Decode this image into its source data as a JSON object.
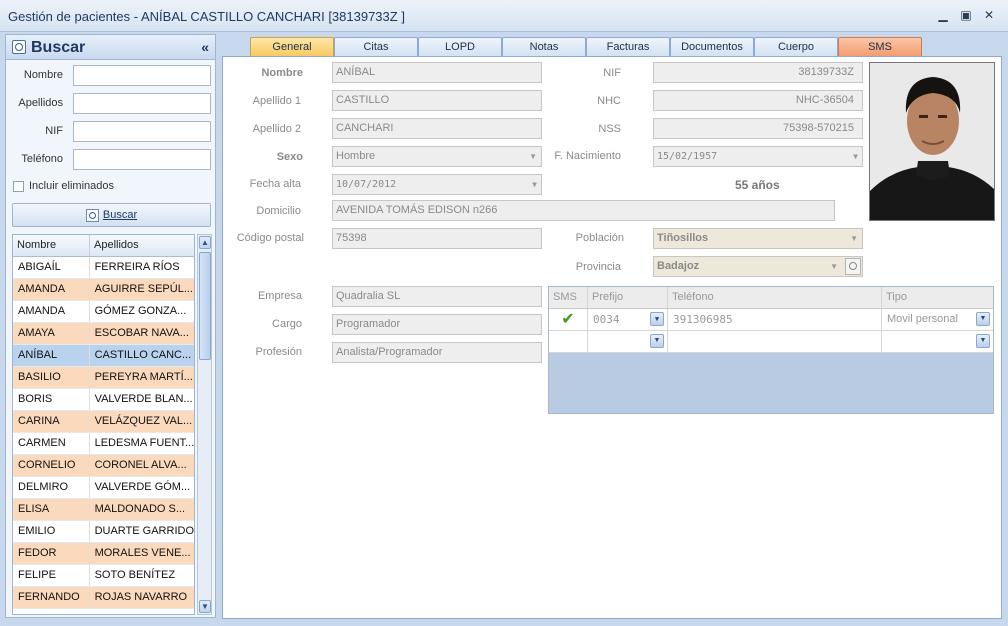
{
  "window": {
    "title": "Gestión de pacientes - ANÍBAL CASTILLO CANCHARI  [38139733Z ]"
  },
  "search": {
    "title": "Buscar",
    "collapse": "«",
    "fields": {
      "nombre_label": "Nombre",
      "apellidos_label": "Apellidos",
      "nif_label": "NIF",
      "telefono_label": "Teléfono"
    },
    "include_deleted_label": "Incluir eliminados",
    "button_label": "Buscar",
    "grid": {
      "columns": [
        "Nombre",
        "Apellidos"
      ],
      "rows": [
        {
          "nombre": "ABIGAÍL",
          "apellidos": "FERREIRA RÍOS"
        },
        {
          "nombre": "AMANDA",
          "apellidos": "AGUIRRE SEPÚL..."
        },
        {
          "nombre": "AMANDA",
          "apellidos": "GÓMEZ GONZA..."
        },
        {
          "nombre": "AMAYA",
          "apellidos": "ESCOBAR NAVA..."
        },
        {
          "nombre": "ANÍBAL",
          "apellidos": "CASTILLO CANC..."
        },
        {
          "nombre": "BASILIO",
          "apellidos": "PEREYRA MARTÍ..."
        },
        {
          "nombre": "BORIS",
          "apellidos": "VALVERDE BLAN..."
        },
        {
          "nombre": "CARINA",
          "apellidos": "VELÁZQUEZ VAL..."
        },
        {
          "nombre": "CARMEN",
          "apellidos": "LEDESMA FUENT..."
        },
        {
          "nombre": "CORNELIO",
          "apellidos": "CORONEL ALVA..."
        },
        {
          "nombre": "DELMIRO",
          "apellidos": "VALVERDE GÓM..."
        },
        {
          "nombre": "ELISA",
          "apellidos": "MALDONADO S..."
        },
        {
          "nombre": "EMILIO",
          "apellidos": "DUARTE GARRIDO"
        },
        {
          "nombre": "FEDOR",
          "apellidos": "MORALES VENE..."
        },
        {
          "nombre": "FELIPE",
          "apellidos": "SOTO BENÍTEZ"
        },
        {
          "nombre": "FERNANDO",
          "apellidos": "ROJAS NAVARRO"
        }
      ]
    }
  },
  "tabs": [
    "General",
    "Citas",
    "LOPD",
    "Notas",
    "Facturas",
    "Documentos",
    "Cuerpo",
    "SMS"
  ],
  "patient": {
    "nombre_label": "Nombre",
    "nombre": "ANÍBAL",
    "apellido1_label": "Apellido 1",
    "apellido1": "CASTILLO",
    "apellido2_label": "Apellido 2",
    "apellido2": "CANCHARI",
    "sexo_label": "Sexo",
    "sexo": "Hombre",
    "fecha_alta_label": "Fecha alta",
    "fecha_alta": "10/07/2012",
    "domicilio_label": "Domicilio",
    "domicilio": "AVENIDA TOMÁS EDISON n266",
    "cp_label": "Código postal",
    "cp": "75398",
    "nif_label": "NIF",
    "nif": "38139733Z",
    "nhc_label": "NHC",
    "nhc": "NHC-36504",
    "nss_label": "NSS",
    "nss": "75398-570215",
    "fnac_label": "F. Nacimiento",
    "fnac": "15/02/1957",
    "edad": "55 años",
    "poblacion_label": "Población",
    "poblacion": "Tiñosillos",
    "provincia_label": "Provincia",
    "provincia": "Badajoz",
    "empresa_label": "Empresa",
    "empresa": "Quadralia SL",
    "cargo_label": "Cargo",
    "cargo": "Programador",
    "profesion_label": "Profesión",
    "profesion": "Analista/Programador"
  },
  "phones": {
    "columns": [
      "SMS",
      "Prefijo",
      "Teléfono",
      "Tipo"
    ],
    "rows": [
      {
        "sms": true,
        "prefijo": "0034",
        "telefono": "391306985",
        "tipo": "Movil personal"
      },
      {
        "sms": false,
        "prefijo": "",
        "telefono": "",
        "tipo": ""
      }
    ]
  },
  "colors": {
    "active_tab": "#f8c85c",
    "sms_tab": "#f49a6c",
    "selected_row": "#b9d3ef",
    "alt_row": "#fbd9bd"
  }
}
